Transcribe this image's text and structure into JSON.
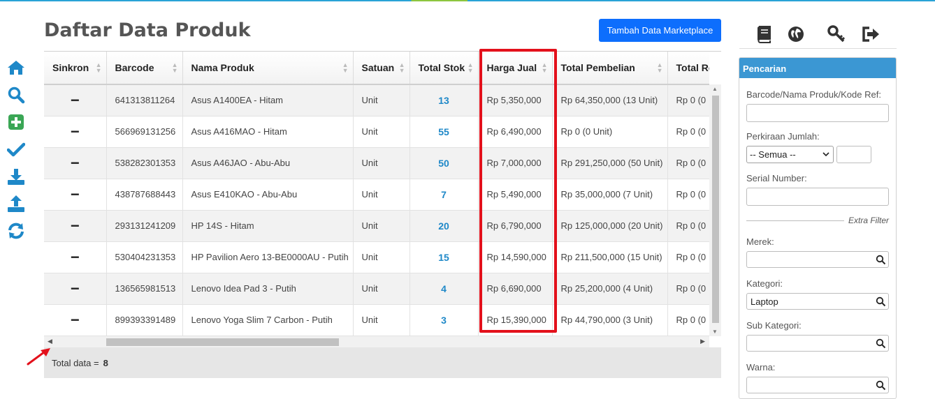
{
  "header": {
    "title": "Daftar Data Produk",
    "add_button": "Tambah Data Marketplace"
  },
  "left_nav": {
    "icons": [
      "home-icon",
      "search-icon",
      "add-icon",
      "check-icon",
      "download-icon",
      "upload-icon",
      "sync-icon"
    ],
    "color": "#1e88c8",
    "add_color": "#3aa655"
  },
  "right_nav": {
    "icons": [
      "book-icon",
      "globe-icon",
      "key-icon",
      "logout-icon"
    ]
  },
  "table": {
    "columns": [
      "Sinkron",
      "Barcode",
      "Nama Produk",
      "Satuan",
      "Total Stok",
      "Harga Jual",
      "Total Pembelian",
      "Total Retu"
    ],
    "rows": [
      {
        "sync": "−",
        "barcode": "641313811264",
        "name": "Asus A1400EA - Hitam",
        "unit": "Unit",
        "stock": "13",
        "price": "Rp 5,350,000",
        "purchase": "Rp 64,350,000 (13 Unit)",
        "retur": "Rp 0 (0"
      },
      {
        "sync": "−",
        "barcode": "566969131256",
        "name": "Asus A416MAO - Hitam",
        "unit": "Unit",
        "stock": "55",
        "price": "Rp 6,490,000",
        "purchase": "Rp 0 (0 Unit)",
        "retur": "Rp 0 (0"
      },
      {
        "sync": "−",
        "barcode": "538282301353",
        "name": "Asus A46JAO - Abu-Abu",
        "unit": "Unit",
        "stock": "50",
        "price": "Rp 7,000,000",
        "purchase": "Rp 291,250,000 (50 Unit)",
        "retur": "Rp 0 (0"
      },
      {
        "sync": "−",
        "barcode": "438787688443",
        "name": "Asus E410KAO - Abu-Abu",
        "unit": "Unit",
        "stock": "7",
        "price": "Rp 5,490,000",
        "purchase": "Rp 35,000,000 (7 Unit)",
        "retur": "Rp 0 (0"
      },
      {
        "sync": "−",
        "barcode": "293131241209",
        "name": "HP 14S - Hitam",
        "unit": "Unit",
        "stock": "20",
        "price": "Rp 6,790,000",
        "purchase": "Rp 125,000,000 (20 Unit)",
        "retur": "Rp 0 (0"
      },
      {
        "sync": "−",
        "barcode": "530404231353",
        "name": "HP Pavilion Aero 13-BE0000AU - Putih",
        "unit": "Unit",
        "stock": "15",
        "price": "Rp 14,590,000",
        "purchase": "Rp 211,500,000 (15 Unit)",
        "retur": "Rp 0 (0"
      },
      {
        "sync": "−",
        "barcode": "136565981513",
        "name": "Lenovo Idea Pad 3 - Putih",
        "unit": "Unit",
        "stock": "4",
        "price": "Rp 6,690,000",
        "purchase": "Rp 25,200,000 (4 Unit)",
        "retur": "Rp 0 (0"
      },
      {
        "sync": "−",
        "barcode": "899393391489",
        "name": "Lenovo Yoga Slim 7 Carbon - Putih",
        "unit": "Unit",
        "stock": "3",
        "price": "Rp 15,390,000",
        "purchase": "Rp 44,790,000 (3 Unit)",
        "retur": "Rp 0 (0"
      }
    ],
    "footer_label": "Total data =",
    "footer_count": "8",
    "highlight_color": "#e3101b"
  },
  "search_panel": {
    "title": "Pencarian",
    "barcode_label": "Barcode/Nama Produk/Kode Ref:",
    "barcode_value": "",
    "qty_label": "Perkiraan Jumlah:",
    "qty_select": "-- Semua --",
    "serial_label": "Serial Number:",
    "extra_filter": "Extra Filter",
    "brand_label": "Merek:",
    "brand_value": "",
    "category_label": "Kategori:",
    "category_value": "Laptop",
    "subcategory_label": "Sub Kategori:",
    "subcategory_value": "",
    "color_label": "Warna:",
    "color_value": ""
  }
}
